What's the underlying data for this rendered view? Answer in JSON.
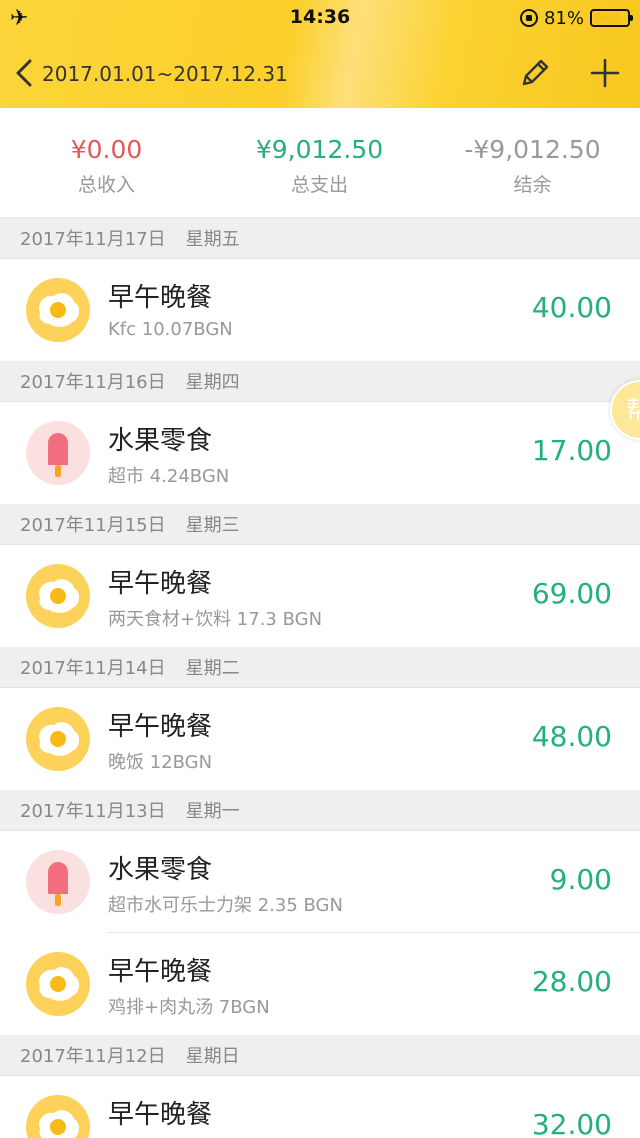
{
  "status_bar": {
    "airplane_icon": "airplane-icon",
    "time": "14:36",
    "battery_text": "81%",
    "battery_level": 0.81
  },
  "nav": {
    "title": "2017.01.01~2017.12.31"
  },
  "summary": {
    "income_value": "¥0.00",
    "income_label": "总收入",
    "expense_value": "¥9,012.50",
    "expense_label": "总支出",
    "balance_value": "-¥9,012.50",
    "balance_label": "结余"
  },
  "float_help": {
    "label": "帮"
  },
  "colors": {
    "accent_yellow": "#fcd02e",
    "income_red": "#e05a5a",
    "expense_green": "#23b07d"
  },
  "days": [
    {
      "date": "2017年11月17日",
      "weekday": "星期五",
      "entries": [
        {
          "icon": "fried-egg-icon",
          "category": "早午晚餐",
          "note": "Kfc 10.07BGN",
          "amount": "40.00"
        }
      ]
    },
    {
      "date": "2017年11月16日",
      "weekday": "星期四",
      "entries": [
        {
          "icon": "popsicle-icon",
          "category": "水果零食",
          "note": "超市 4.24BGN",
          "amount": "17.00"
        }
      ]
    },
    {
      "date": "2017年11月15日",
      "weekday": "星期三",
      "entries": [
        {
          "icon": "fried-egg-icon",
          "category": "早午晚餐",
          "note": "两天食材+饮料 17.3 BGN",
          "amount": "69.00"
        }
      ]
    },
    {
      "date": "2017年11月14日",
      "weekday": "星期二",
      "entries": [
        {
          "icon": "fried-egg-icon",
          "category": "早午晚餐",
          "note": "晚饭 12BGN",
          "amount": "48.00"
        }
      ]
    },
    {
      "date": "2017年11月13日",
      "weekday": "星期一",
      "entries": [
        {
          "icon": "popsicle-icon",
          "category": "水果零食",
          "note": "超市水可乐士力架 2.35 BGN",
          "amount": "9.00"
        },
        {
          "icon": "fried-egg-icon",
          "category": "早午晚餐",
          "note": "鸡排+肉丸汤 7BGN",
          "amount": "28.00"
        }
      ]
    },
    {
      "date": "2017年11月12日",
      "weekday": "星期日",
      "entries": [
        {
          "icon": "fried-egg-icon",
          "category": "早午晚餐",
          "note": "",
          "amount": "32.00"
        }
      ]
    }
  ]
}
